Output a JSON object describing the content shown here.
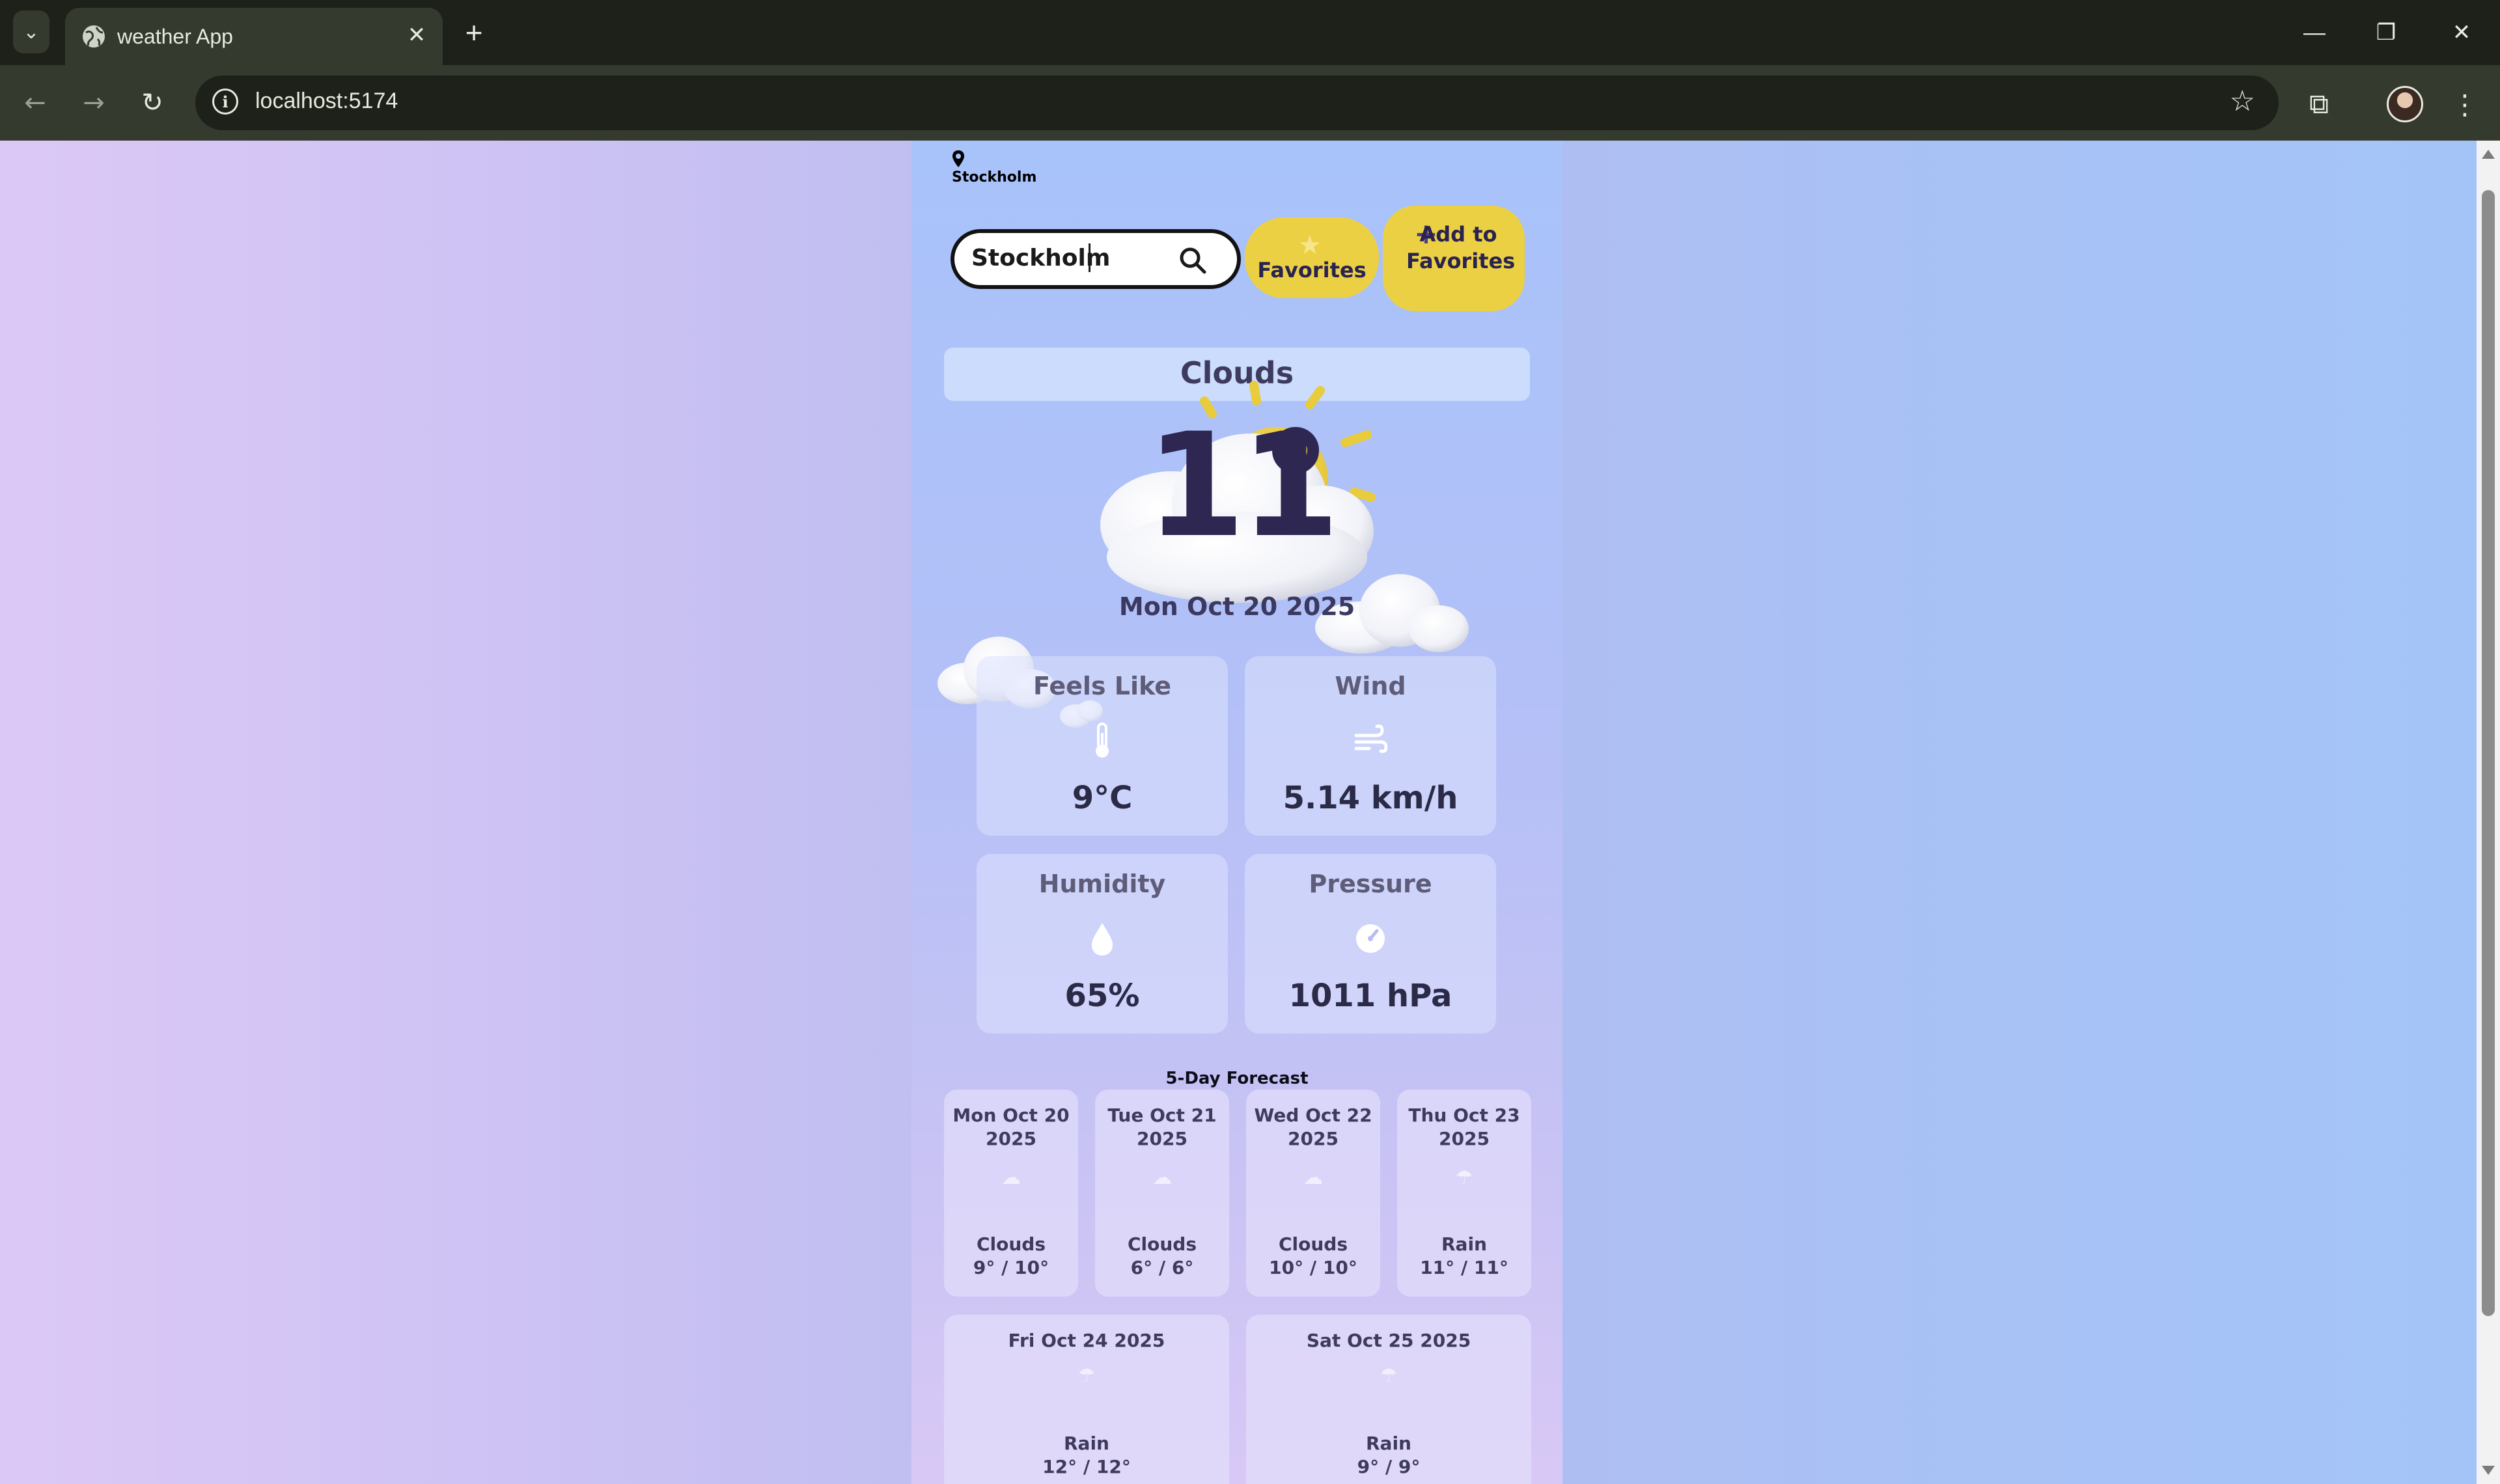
{
  "browser": {
    "tab_title": "weather App",
    "url": "localhost:5174",
    "new_tab_label": "+",
    "tab_close": "✕"
  },
  "app": {
    "location_name": "Stockholm",
    "search": {
      "value": "Stockholm"
    },
    "favorites_button": "Favorites",
    "add_favorites_button": "Add to Favorites",
    "condition": "Clouds",
    "temperature": "11",
    "date": "Mon Oct 20 2025",
    "stats": [
      {
        "label": "Feels Like",
        "value": "9°C",
        "icon": "thermometer-icon"
      },
      {
        "label": "Wind",
        "value": "5.14 km/h",
        "icon": "wind-icon"
      },
      {
        "label": "Humidity",
        "value": "65%",
        "icon": "droplet-icon"
      },
      {
        "label": "Pressure",
        "value": "1011 hPa",
        "icon": "gauge-icon"
      }
    ],
    "forecast_heading": "5-Day Forecast",
    "forecast": [
      {
        "date": "Mon Oct 20 2025",
        "condition": "Clouds",
        "range": "9° / 10°",
        "icon": "cloud-icon"
      },
      {
        "date": "Tue Oct 21 2025",
        "condition": "Clouds",
        "range": "6° / 6°",
        "icon": "cloud-icon"
      },
      {
        "date": "Wed Oct 22 2025",
        "condition": "Clouds",
        "range": "10° / 10°",
        "icon": "cloud-icon"
      },
      {
        "date": "Thu Oct 23 2025",
        "condition": "Rain",
        "range": "11° / 11°",
        "icon": "rain-icon"
      },
      {
        "date": "Fri Oct 24 2025",
        "condition": "Rain",
        "range": "12° / 12°",
        "icon": "rain-icon"
      },
      {
        "date": "Sat Oct 25 2025",
        "condition": "Rain",
        "range": "9° / 9°",
        "icon": "rain-icon"
      }
    ]
  },
  "colors": {
    "accent_yellow": "#ebd043",
    "text_dark": "#2d2752",
    "chrome_bg": "#1d2119"
  }
}
